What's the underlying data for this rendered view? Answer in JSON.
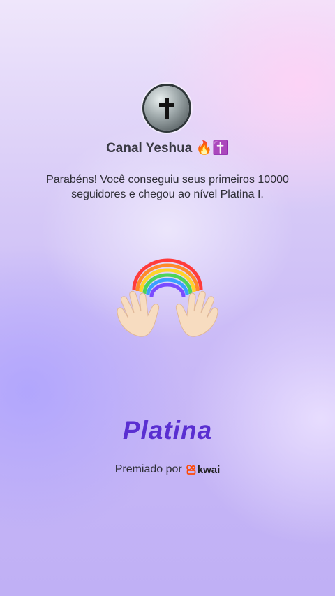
{
  "profile": {
    "avatar_icon": "cross-icon",
    "channel_name": "Canal Yeshua",
    "name_emojis": "🔥✝️"
  },
  "message": "Parabéns! Você conseguiu seus primeiros 10000 seguidores e chegou ao nível Platina I.",
  "badge": {
    "icon": "rainbow-hands-icon",
    "level_name": "Platina"
  },
  "footer": {
    "awarded_by_label": "Premiado por",
    "brand_name": "kwai",
    "brand_color": "#ff4906"
  },
  "colors": {
    "level_text": "#5a2fd1",
    "accent_bg": "#c9b9f7"
  }
}
